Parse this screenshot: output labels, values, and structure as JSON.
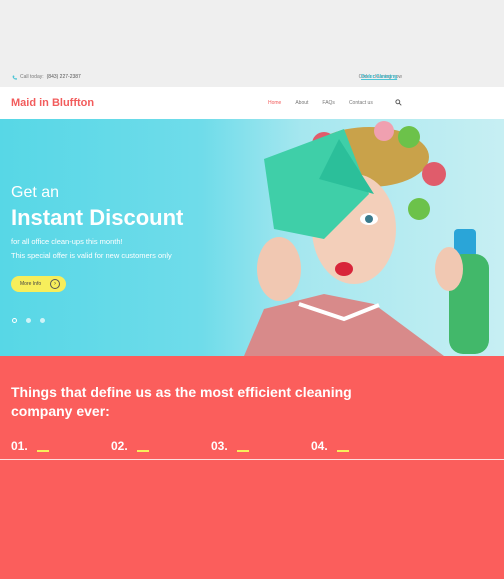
{
  "topbar": {
    "call_label": "Call today:",
    "phone": "(843) 227-2387",
    "order_text": "Order cleaning now",
    "order_link": "Order Cleaning"
  },
  "brand": {
    "logo": "Maid in Bluffton"
  },
  "menu": {
    "items": [
      {
        "label": "Home",
        "active": true
      },
      {
        "label": "About"
      },
      {
        "label": "FAQs"
      },
      {
        "label": "Contact us"
      }
    ]
  },
  "hero": {
    "get_an": "Get an",
    "headline": "Instant Discount",
    "line1": "for all office clean-ups this month!",
    "line2": "This special offer is valid for new customers only",
    "button": "More Info",
    "slides": 3
  },
  "features": {
    "title": "Things that define us as the most efficient cleaning company ever:",
    "steps": [
      "01.",
      "02.",
      "03.",
      "04."
    ]
  },
  "colors": {
    "accent": "#fb5e5c",
    "cyan": "#57d7e6",
    "yellow": "#f7ee5b"
  }
}
